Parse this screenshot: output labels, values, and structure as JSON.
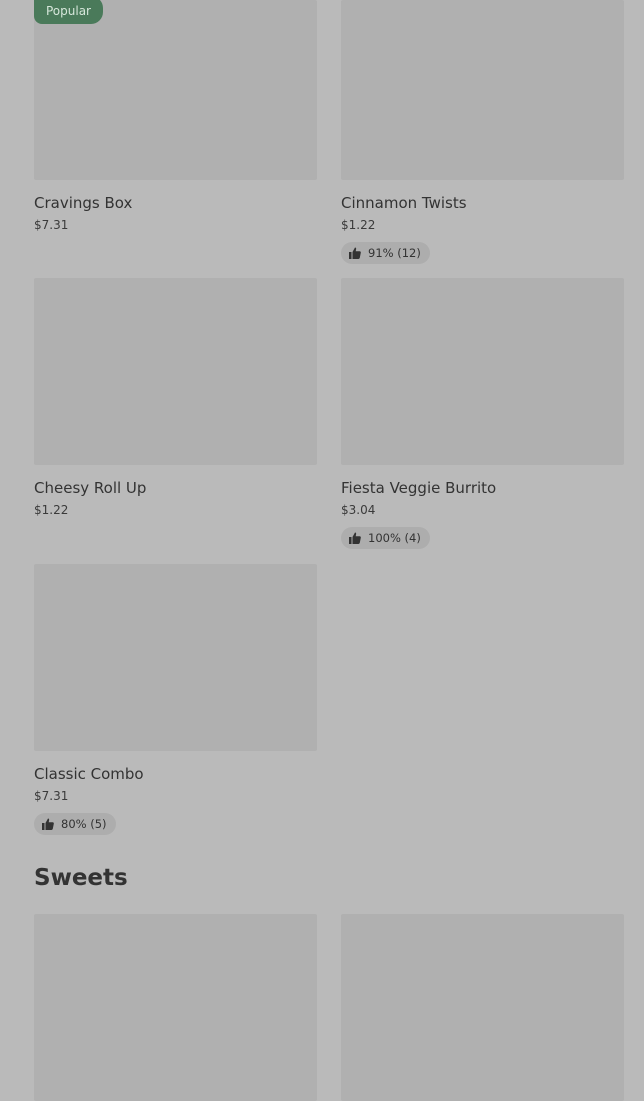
{
  "items": [
    {
      "name": "Cravings Box",
      "price": "$7.31",
      "badge": "Popular",
      "rating": null
    },
    {
      "name": "Cinnamon Twists",
      "price": "$1.22",
      "badge": null,
      "rating": "91% (12)"
    },
    {
      "name": "Cheesy Roll Up",
      "price": "$1.22",
      "badge": null,
      "rating": null
    },
    {
      "name": "Fiesta Veggie Burrito",
      "price": "$3.04",
      "badge": null,
      "rating": "100% (4)"
    },
    {
      "name": "Classic Combo",
      "price": "$7.31",
      "badge": null,
      "rating": "80% (5)"
    }
  ],
  "sections": {
    "sweets_title": "Sweets"
  },
  "icons": {
    "rating": "thumbs-up-icon"
  }
}
